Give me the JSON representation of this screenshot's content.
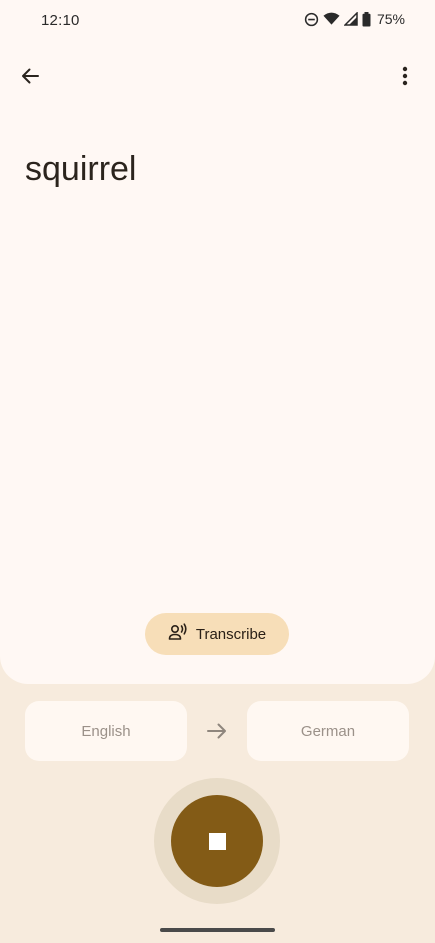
{
  "status_bar": {
    "time": "12:10",
    "battery_percent": "75%",
    "icons": [
      "dnd-icon",
      "wifi-icon",
      "signal-icon",
      "battery-icon"
    ]
  },
  "app_bar": {
    "back_icon": "arrow-back-icon",
    "more_icon": "more-vert-icon"
  },
  "transcript": {
    "text": "squirrel"
  },
  "transcribe_button": {
    "label": "Transcribe",
    "icon": "voice-person-icon"
  },
  "languages": {
    "source": "English",
    "target": "German",
    "arrow_icon": "arrow-right-icon"
  },
  "record": {
    "state": "recording",
    "icon": "stop-icon"
  },
  "colors": {
    "background": "#f7ebdd",
    "card": "#fff8f4",
    "accent": "#835b16",
    "chip": "#f7deb8"
  }
}
